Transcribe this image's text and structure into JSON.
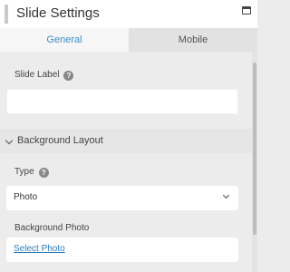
{
  "header": {
    "title": "Slide Settings",
    "window_icon": "window-icon"
  },
  "tabs": [
    {
      "label": "General",
      "active": true
    },
    {
      "label": "Mobile",
      "active": false
    }
  ],
  "fields": {
    "slide_label": {
      "label": "Slide Label",
      "value": ""
    },
    "type": {
      "label": "Type",
      "selected": "Photo"
    },
    "background_photo": {
      "label": "Background Photo",
      "link": "Select Photo"
    }
  },
  "section": {
    "title": "Background Layout",
    "expanded": true
  },
  "colors": {
    "accent": "#3a8fc7",
    "link": "#2b7bb9",
    "background": "#ececec"
  },
  "icons": [
    "drag-handle-icon",
    "window-icon",
    "help-icon",
    "chevron-down-icon"
  ]
}
